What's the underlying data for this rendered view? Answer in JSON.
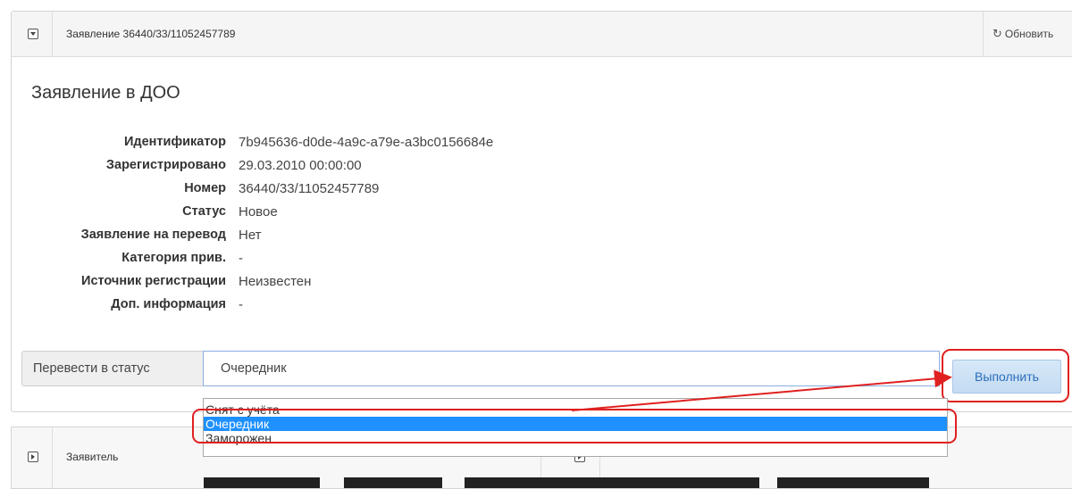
{
  "header": {
    "title": "Заявление 36440/33/11052457789",
    "refresh_label": "Обновить",
    "refresh_icon": "refresh-icon"
  },
  "section_title": "Заявление в ДОО",
  "details": [
    {
      "label": "Идентификатор",
      "value": "7b945636-d0de-4a9c-a79e-a3bc0156684e"
    },
    {
      "label": "Зарегистрировано",
      "value": "29.03.2010 00:00:00"
    },
    {
      "label": "Номер",
      "value": "36440/33/11052457789"
    },
    {
      "label": "Статус",
      "value": "Новое"
    },
    {
      "label": "Заявление на перевод",
      "value": "Нет"
    },
    {
      "label": "Категория прив.",
      "value": "-"
    },
    {
      "label": "Источник регистрации",
      "value": "Неизвестен"
    },
    {
      "label": "Доп. информация",
      "value": "-"
    }
  ],
  "action": {
    "label": "Перевести в статус",
    "selected": "Очередник",
    "button_label": "Выполнить",
    "options": [
      "Снят с учёта",
      "Очередник",
      "Заморожен"
    ],
    "selected_index": 1
  },
  "panel2": {
    "title": "Заявитель"
  },
  "colors": {
    "highlight": "#e02020",
    "selected_option": "#1e90ff",
    "button_text": "#2a6ebb"
  }
}
